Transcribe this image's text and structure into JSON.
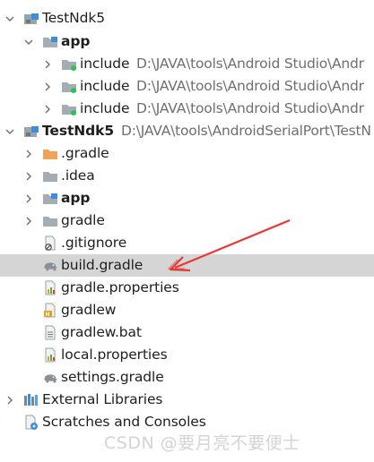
{
  "tree": {
    "items": [
      {
        "label": "TestNdk5",
        "path": "",
        "arrow": "down",
        "icon": "module-icon",
        "bold": false,
        "selected": false
      },
      {
        "label": "app",
        "path": "",
        "arrow": "down",
        "icon": "module-folder-icon",
        "bold": true,
        "selected": false
      },
      {
        "label": "include",
        "path": "D:\\JAVA\\tools\\Android Studio\\Andr",
        "arrow": "right",
        "icon": "include-folder-icon",
        "bold": false,
        "selected": false
      },
      {
        "label": "include",
        "path": "D:\\JAVA\\tools\\Android Studio\\Andr",
        "arrow": "right",
        "icon": "include-folder-icon",
        "bold": false,
        "selected": false
      },
      {
        "label": "include",
        "path": "D:\\JAVA\\tools\\Android Studio\\Andr",
        "arrow": "right",
        "icon": "include-folder-icon",
        "bold": false,
        "selected": false
      },
      {
        "label": "TestNdk5",
        "path": "D:\\JAVA\\tools\\AndroidSerialPort\\TestN",
        "arrow": "down",
        "icon": "module-icon",
        "bold": true,
        "selected": false
      },
      {
        "label": ".gradle",
        "path": "",
        "arrow": "right",
        "icon": "orange-folder-icon",
        "bold": false,
        "selected": false
      },
      {
        "label": ".idea",
        "path": "",
        "arrow": "right",
        "icon": "folder-icon",
        "bold": false,
        "selected": false
      },
      {
        "label": "app",
        "path": "",
        "arrow": "right",
        "icon": "module-folder-icon",
        "bold": true,
        "selected": false
      },
      {
        "label": "gradle",
        "path": "",
        "arrow": "right",
        "icon": "folder-icon",
        "bold": false,
        "selected": false
      },
      {
        "label": ".gitignore",
        "path": "",
        "arrow": "none",
        "icon": "gitignore-icon",
        "bold": false,
        "selected": false
      },
      {
        "label": "build.gradle",
        "path": "",
        "arrow": "none",
        "icon": "gradle-elephant-icon",
        "bold": false,
        "selected": true
      },
      {
        "label": "gradle.properties",
        "path": "",
        "arrow": "none",
        "icon": "properties-icon",
        "bold": false,
        "selected": false
      },
      {
        "label": "gradlew",
        "path": "",
        "arrow": "none",
        "icon": "shell-script-icon",
        "bold": false,
        "selected": false
      },
      {
        "label": "gradlew.bat",
        "path": "",
        "arrow": "none",
        "icon": "text-file-icon",
        "bold": false,
        "selected": false
      },
      {
        "label": "local.properties",
        "path": "",
        "arrow": "none",
        "icon": "properties-icon",
        "bold": false,
        "selected": false
      },
      {
        "label": "settings.gradle",
        "path": "",
        "arrow": "none",
        "icon": "gradle-elephant-icon",
        "bold": false,
        "selected": false
      },
      {
        "label": "External Libraries",
        "path": "",
        "arrow": "right",
        "icon": "libraries-icon",
        "bold": false,
        "selected": false
      },
      {
        "label": "Scratches and Consoles",
        "path": "",
        "arrow": "none",
        "icon": "scratches-icon",
        "bold": false,
        "selected": false
      }
    ]
  },
  "watermark": "CSDN @要月亮不要便士",
  "colors": {
    "selection": "#d5d5d5",
    "annotation_arrow": "#e53935",
    "folder": "#a4acb4",
    "orange_folder": "#f0a35c",
    "module_badge": "#3d8ed9",
    "include_badge": "#2ec255"
  }
}
